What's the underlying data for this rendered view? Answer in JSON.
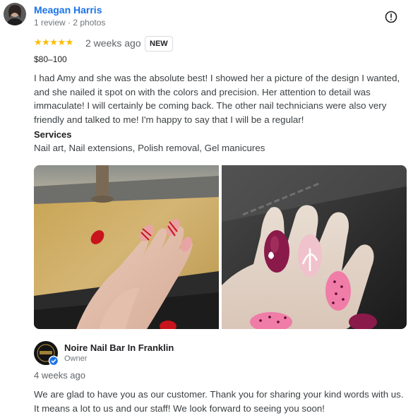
{
  "reviewer": {
    "name": "Meagan Harris",
    "meta": "1 review · 2 photos"
  },
  "rating": {
    "stars_text": "★★★★★",
    "value": 5,
    "date": "2 weeks ago",
    "badge": "NEW"
  },
  "price": "$80–100",
  "review_text": "I had Amy and she was the absolute best! I showed her a picture of the design I wanted, and she nailed it spot on with the colors and precision. Her attention to detail was immaculate! I will certainly be coming back. The other nail technicians were also very friendly and talked to me! I'm happy to say that I will be a regular!",
  "services": {
    "title": "Services",
    "list": "Nail art, Nail extensions, Polish removal, Gel manicures"
  },
  "owner": {
    "name": "Noire Nail Bar In Franklin",
    "role": "Owner",
    "date": "4 weeks ago",
    "response": "We are glad to have you as our customer. Thank you for sharing your kind words with us. It means a lot to us and our staff! We look forward to seeing you soon!"
  },
  "icons": {
    "flag": "report-icon",
    "verified": "verified-badge-icon"
  },
  "colors": {
    "name_link": "#1a73e8",
    "star": "#fbbc04",
    "verified": "#1a73e8"
  }
}
